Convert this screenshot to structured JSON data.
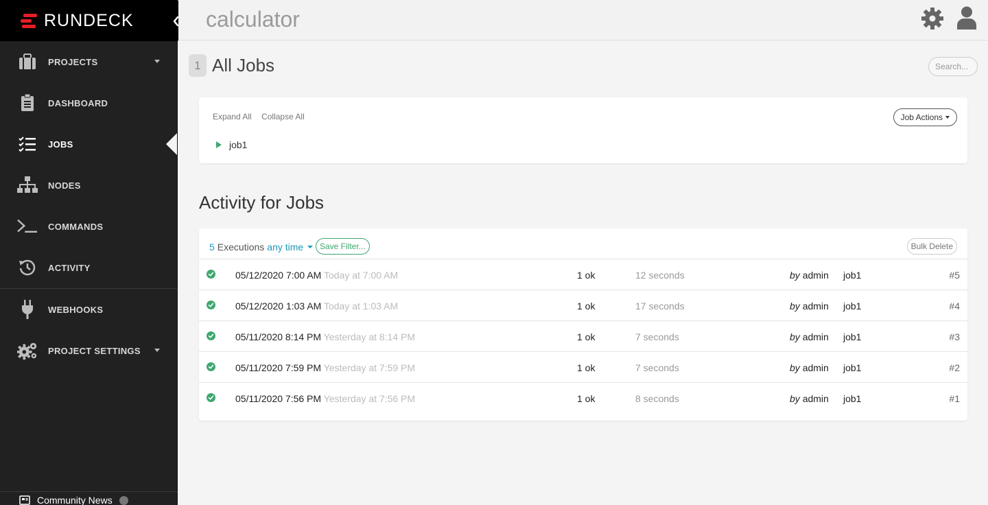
{
  "brand": {
    "name": "RUNDECK",
    "accent": "#e41e26"
  },
  "sidebar": {
    "items": [
      {
        "label": "PROJECTS",
        "icon": "briefcase-icon",
        "dropdown": true
      },
      {
        "label": "DASHBOARD",
        "icon": "clipboard-icon"
      },
      {
        "label": "JOBS",
        "icon": "tasks-icon",
        "active": true
      },
      {
        "label": "NODES",
        "icon": "sitemap-icon"
      },
      {
        "label": "COMMANDS",
        "icon": "terminal-icon"
      },
      {
        "label": "ACTIVITY",
        "icon": "history-icon"
      },
      {
        "label": "WEBHOOKS",
        "icon": "plug-icon"
      },
      {
        "label": "PROJECT SETTINGS",
        "icon": "cogs-icon",
        "dropdown": true
      }
    ],
    "community": "Community News"
  },
  "header": {
    "project": "calculator"
  },
  "jobs": {
    "count": "1",
    "heading": "All Jobs",
    "search_placeholder": "Search...",
    "expand_all": "Expand All",
    "collapse_all": "Collapse All",
    "job_actions": "Job Actions",
    "list": [
      {
        "name": "job1"
      }
    ]
  },
  "activity": {
    "heading": "Activity for Jobs",
    "count": "5",
    "executions_label": "Executions",
    "time_filter": "any time",
    "save_filter": "Save Filter...",
    "bulk_delete": "Bulk Delete",
    "status_color": "#3fa76f",
    "rows": [
      {
        "date": "05/12/2020 7:00 AM",
        "relative": "Today at 7:00 AM",
        "result": "1 ok",
        "duration": "12 seconds",
        "by": "by",
        "user": "admin",
        "job": "job1",
        "id": "#5"
      },
      {
        "date": "05/12/2020 1:03 AM",
        "relative": "Today at 1:03 AM",
        "result": "1 ok",
        "duration": "17 seconds",
        "by": "by",
        "user": "admin",
        "job": "job1",
        "id": "#4"
      },
      {
        "date": "05/11/2020 8:14 PM",
        "relative": "Yesterday at 8:14 PM",
        "result": "1 ok",
        "duration": "7 seconds",
        "by": "by",
        "user": "admin",
        "job": "job1",
        "id": "#3"
      },
      {
        "date": "05/11/2020 7:59 PM",
        "relative": "Yesterday at 7:59 PM",
        "result": "1 ok",
        "duration": "7 seconds",
        "by": "by",
        "user": "admin",
        "job": "job1",
        "id": "#2"
      },
      {
        "date": "05/11/2020 7:56 PM",
        "relative": "Yesterday at 7:56 PM",
        "result": "1 ok",
        "duration": "8 seconds",
        "by": "by",
        "user": "admin",
        "job": "job1",
        "id": "#1"
      }
    ]
  }
}
